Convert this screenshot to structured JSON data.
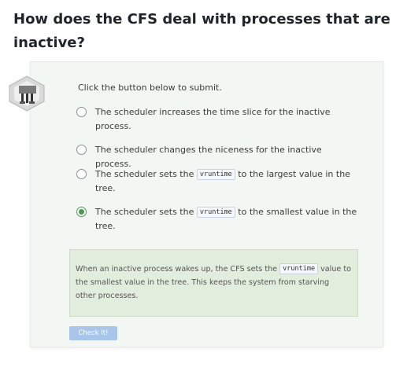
{
  "question": {
    "title": "How does the CFS deal with processes that are inactive?"
  },
  "badge": {
    "icon": "network-hub-icon"
  },
  "prompt": "Click the button below to submit.",
  "options": [
    {
      "parts": [
        "The scheduler increases the time slice for the inactive process."
      ],
      "selected": false
    },
    {
      "parts": [
        "The scheduler changes the niceness for the inactive process."
      ],
      "selected": false
    },
    {
      "before": "The scheduler sets the ",
      "code": "vruntime",
      "after": " to the largest value in the tree.",
      "selected": false
    },
    {
      "before": "The scheduler sets the ",
      "code": "vruntime",
      "after": " to the smallest value in the tree.",
      "selected": true
    }
  ],
  "feedback": {
    "before": "When an inactive process wakes up, the CFS sets the ",
    "code": "vruntime",
    "after": " value to the smallest value in the tree. This keeps the system from starving other processes."
  },
  "check_button": {
    "label": "Check It!"
  },
  "colors": {
    "card_bg": "#f3f7f3",
    "feedback_bg": "#e3eddd",
    "selected_radio": "#4a9a4e",
    "button_bg": "#a9c5ec"
  }
}
